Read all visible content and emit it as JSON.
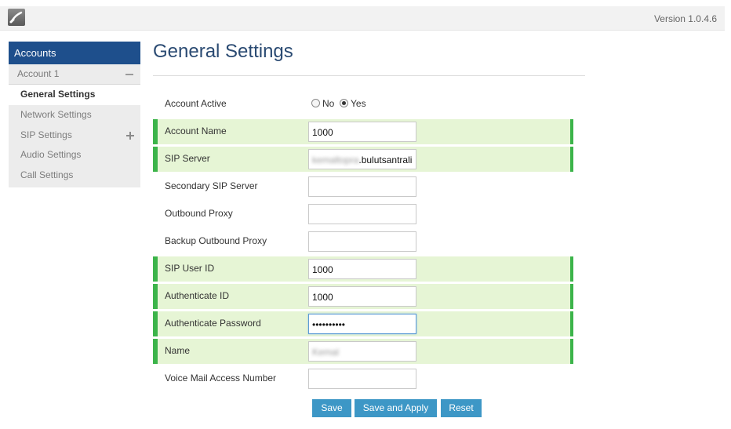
{
  "header": {
    "version": "Version 1.0.4.6",
    "logo_icon": "phone-icon"
  },
  "sidebar": {
    "title": "Accounts",
    "account": "Account 1",
    "items": [
      {
        "label": "General Settings",
        "active": true
      },
      {
        "label": "Network Settings"
      },
      {
        "label": "SIP Settings",
        "expandable": true
      },
      {
        "label": "Audio Settings"
      },
      {
        "label": "Call Settings"
      }
    ]
  },
  "page": {
    "title": "General Settings"
  },
  "form": {
    "account_active": {
      "label": "Account Active",
      "no": "No",
      "yes": "Yes",
      "selected": "Yes"
    },
    "account_name": {
      "label": "Account Name",
      "value": "1000"
    },
    "sip_server": {
      "label": "SIP Server",
      "value_hidden": "kemaltopra",
      "value": ".bulutsantrali"
    },
    "secondary_sip_server": {
      "label": "Secondary SIP Server",
      "value": ""
    },
    "outbound_proxy": {
      "label": "Outbound Proxy",
      "value": ""
    },
    "backup_outbound_proxy": {
      "label": "Backup Outbound Proxy",
      "value": ""
    },
    "sip_user_id": {
      "label": "SIP User ID",
      "value": "1000"
    },
    "authenticate_id": {
      "label": "Authenticate ID",
      "value": "1000"
    },
    "authenticate_password": {
      "label": "Authenticate Password",
      "value": "••••••••••"
    },
    "name": {
      "label": "Name",
      "value": "Kemal"
    },
    "voice_mail": {
      "label": "Voice Mail Access Number",
      "value": ""
    }
  },
  "buttons": {
    "save": "Save",
    "save_apply": "Save and Apply",
    "reset": "Reset"
  },
  "colors": {
    "accent": "#1e4f8c",
    "highlight_bg": "#e6f5d5",
    "highlight_border": "#3cb44a",
    "button": "#3d97c6"
  }
}
